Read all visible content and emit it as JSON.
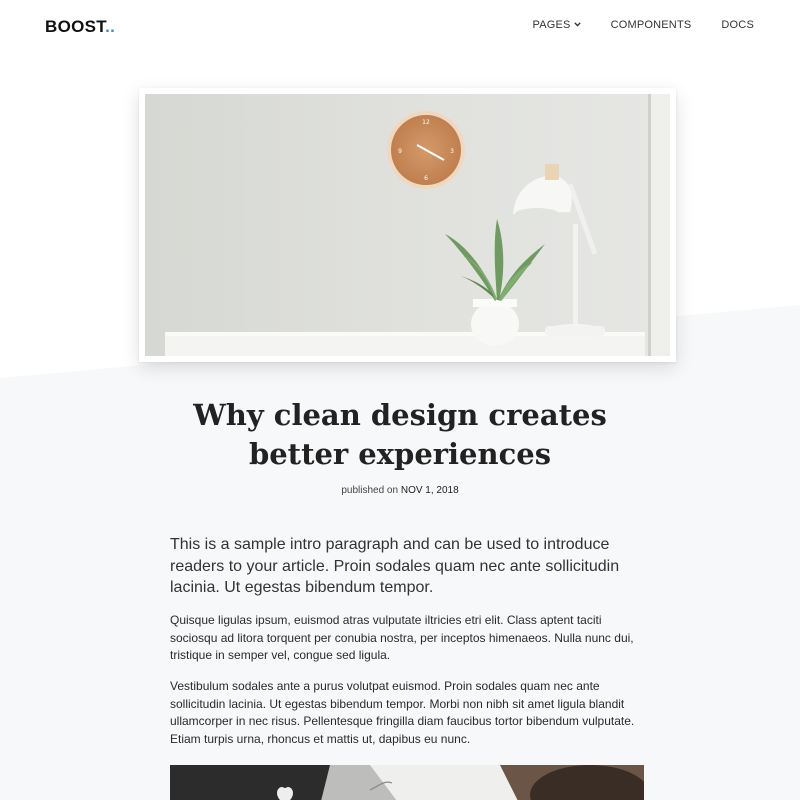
{
  "nav": {
    "brand_text": "BOOST",
    "brand_dots": "..",
    "links": [
      {
        "label": "PAGES",
        "has_dropdown": true
      },
      {
        "label": "COMPONENTS",
        "has_dropdown": false
      },
      {
        "label": "DOCS",
        "has_dropdown": false
      }
    ],
    "dropdown_icon": "chevron-down-icon"
  },
  "hero_image": {
    "description_icon": "photo-desk-clock-plant-lamp"
  },
  "article": {
    "title": "Why clean design creates better experiences",
    "meta_prefix": "published on",
    "meta_date": "NOV 1, 2018",
    "intro": "This is a sample intro paragraph and can be used to introduce readers to your article. Proin sodales quam nec ante sollicitudin lacinia. Ut egestas bibendum tempor.",
    "paragraphs": [
      "Quisque ligulas ipsum, euismod atras vulputate iltricies etri elit. Class aptent taciti sociosqu ad litora torquent per conubia nostra, per inceptos himenaeos. Nulla nunc dui, tristique in semper vel, congue sed ligula.",
      "Vestibulum sodales ante a purus volutpat euismod. Proin sodales quam nec ante sollicitudin lacinia. Ut egestas bibendum tempor. Morbi non nibh sit amet ligula blandit ullamcorper in nec risus. Pellentesque fringilla diam faucibus tortor bibendum vulputate. Etiam turpis urna, rhoncus et mattis ut, dapibus eu nunc."
    ]
  },
  "colors": {
    "accent": "#3b8fd6",
    "text": "#222222",
    "band_bg": "#f7f8fa"
  }
}
